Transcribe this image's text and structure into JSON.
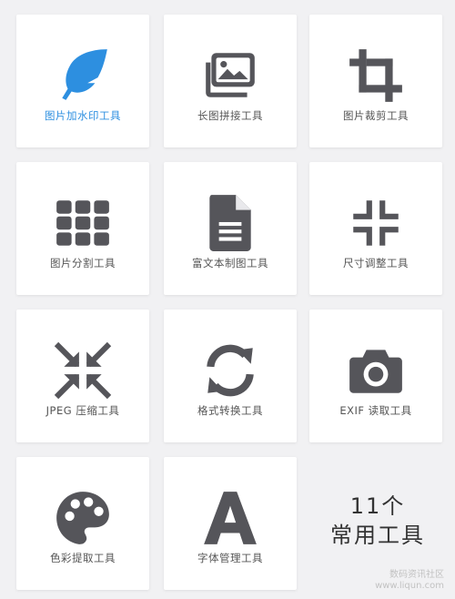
{
  "colors": {
    "background": "#f1f1f3",
    "card": "#ffffff",
    "icon": "#55555a",
    "accent": "#2d8fe0",
    "label": "#555555"
  },
  "tools": [
    {
      "label": "图片加水印工具",
      "icon": "feather-icon",
      "active": true
    },
    {
      "label": "长图拼接工具",
      "icon": "images-icon",
      "active": false
    },
    {
      "label": "图片裁剪工具",
      "icon": "crop-icon",
      "active": false
    },
    {
      "label": "图片分割工具",
      "icon": "grid-icon",
      "active": false
    },
    {
      "label": "富文本制图工具",
      "icon": "document-icon",
      "active": false
    },
    {
      "label": "尺寸调整工具",
      "icon": "resize-icon",
      "active": false
    },
    {
      "label": "JPEG 压缩工具",
      "icon": "compress-icon",
      "active": false
    },
    {
      "label": "格式转换工具",
      "icon": "convert-icon",
      "active": false
    },
    {
      "label": "EXIF 读取工具",
      "icon": "camera-icon",
      "active": false
    },
    {
      "label": "色彩提取工具",
      "icon": "palette-icon",
      "active": false
    },
    {
      "label": "字体管理工具",
      "icon": "font-icon",
      "active": false
    }
  ],
  "summary": {
    "line1": "11个",
    "line2": "常用工具"
  },
  "watermark": {
    "line1": "数码资讯社区",
    "line2": "www.liqun.com"
  }
}
